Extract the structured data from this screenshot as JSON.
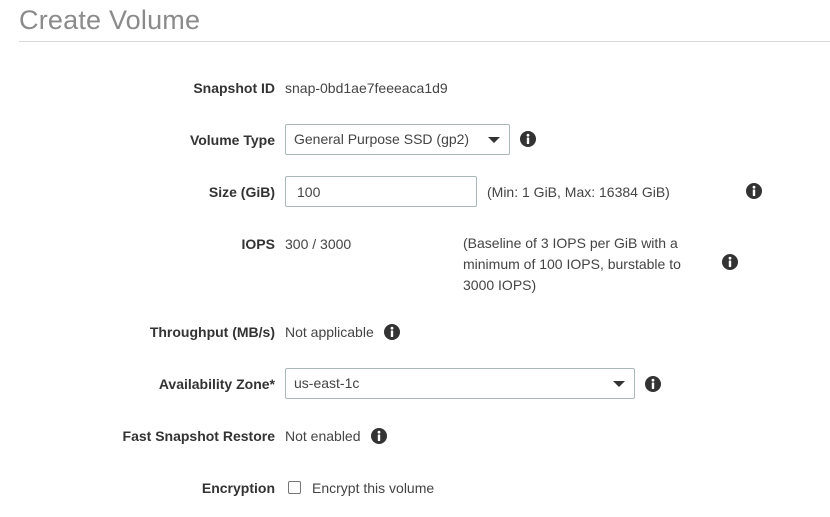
{
  "header": {
    "title": "Create Volume"
  },
  "form": {
    "snapshot_id": {
      "label": "Snapshot ID",
      "value": "snap-0bd1ae7feeeaca1d9"
    },
    "volume_type": {
      "label": "Volume Type",
      "selected": "General Purpose SSD (gp2)"
    },
    "size": {
      "label": "Size (GiB)",
      "value": "100",
      "hint": "(Min: 1 GiB, Max: 16384 GiB)"
    },
    "iops": {
      "label": "IOPS",
      "value": "300 / 3000",
      "hint_line1": "(Baseline of 3 IOPS per GiB with a",
      "hint_line2": "minimum of 100 IOPS, burstable to",
      "hint_line3": "3000 IOPS)"
    },
    "throughput": {
      "label": "Throughput (MB/s)",
      "value": "Not applicable"
    },
    "availability_zone": {
      "label": "Availability Zone*",
      "selected": "us-east-1c"
    },
    "fast_snapshot_restore": {
      "label": "Fast Snapshot Restore",
      "value": "Not enabled"
    },
    "encryption": {
      "label": "Encryption",
      "checkbox_label": "Encrypt this volume",
      "checked": false
    }
  },
  "icons": {
    "info": "info-icon",
    "dropdown": "chevron-down-icon",
    "info_color": "#333333"
  }
}
